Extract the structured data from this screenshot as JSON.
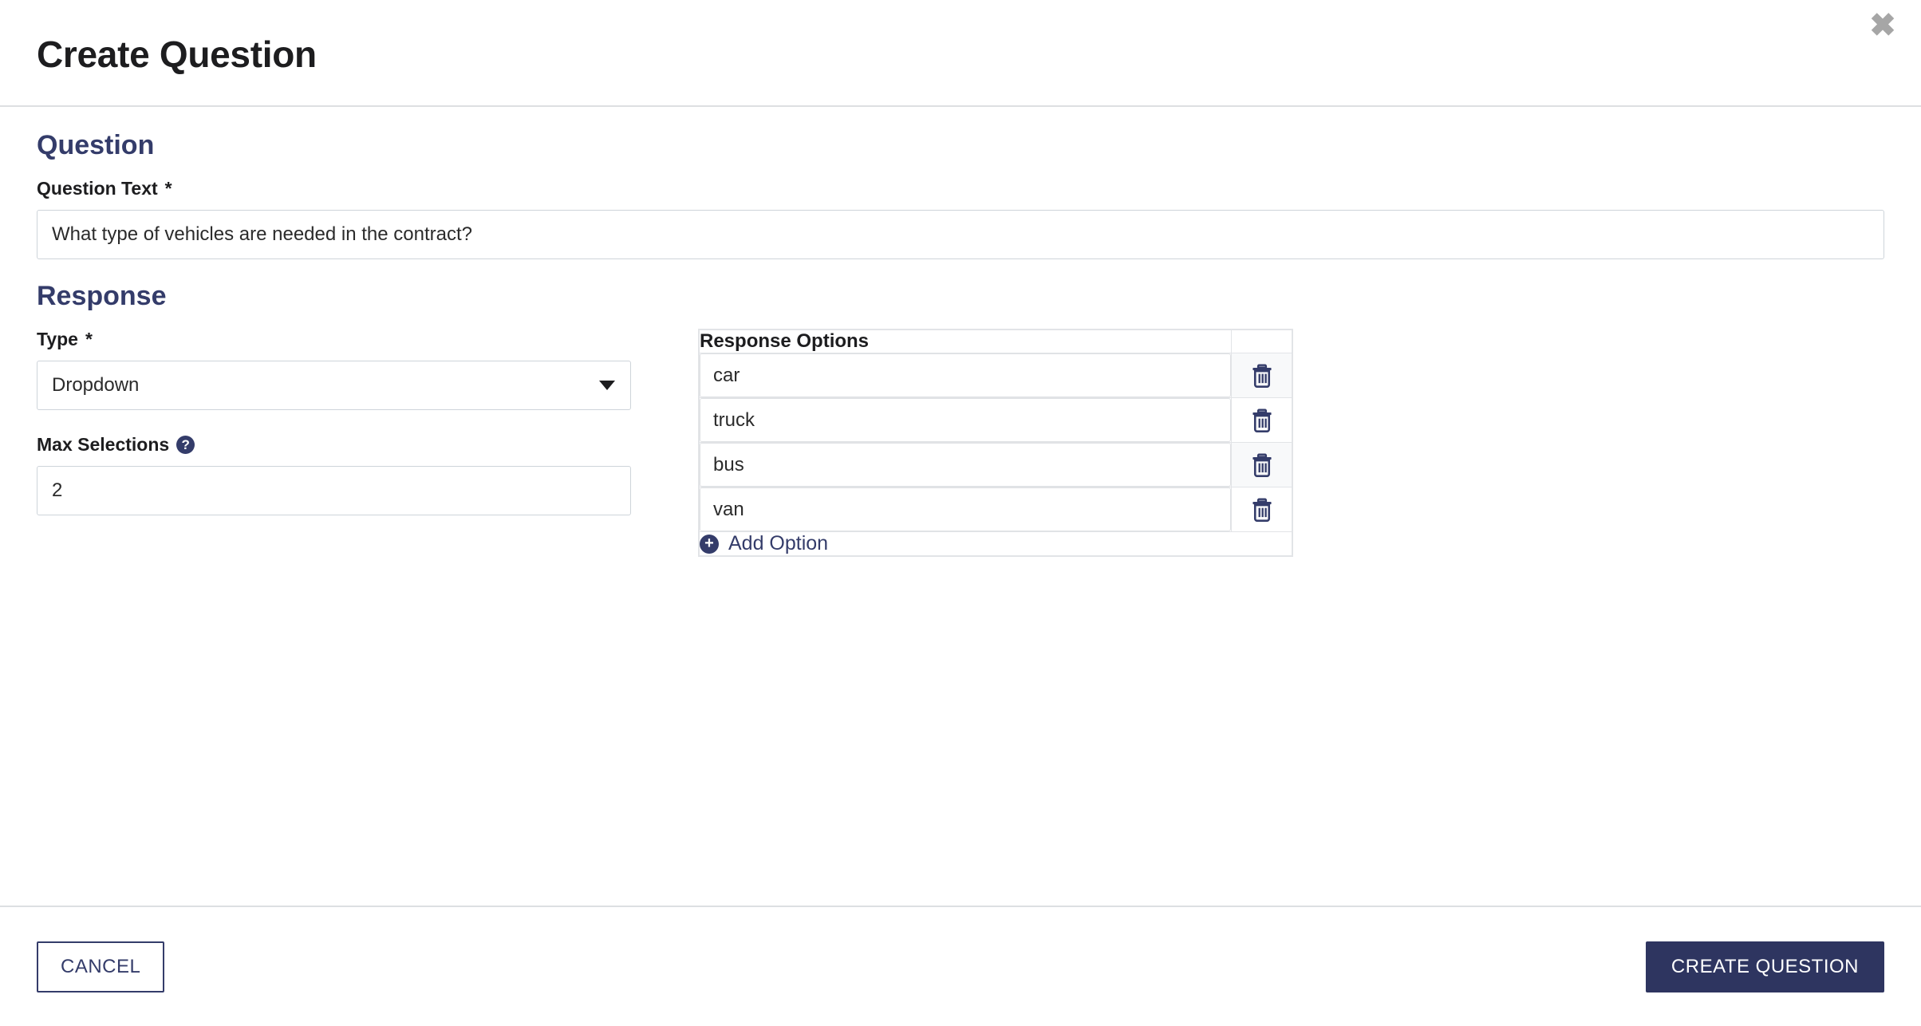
{
  "modal": {
    "title": "Create Question",
    "close_label": "✖"
  },
  "question_section": {
    "heading": "Question",
    "question_text_label": "Question Text",
    "required_marker": "*",
    "question_text_value": "What type of vehicles are needed in the contract?",
    "question_text_placeholder": ""
  },
  "response_section": {
    "heading": "Response",
    "type_label": "Type",
    "type_required_marker": "*",
    "type_value": "Dropdown",
    "type_options": [
      "Dropdown"
    ],
    "max_selections_label": "Max Selections",
    "max_selections_help": "?",
    "max_selections_value": "2",
    "max_selections_placeholder": ""
  },
  "options_table": {
    "header": "Response Options",
    "actions_header": "",
    "rows": [
      {
        "value": "car",
        "delete_label": "delete-option"
      },
      {
        "value": "truck",
        "delete_label": "delete-option"
      },
      {
        "value": "bus",
        "delete_label": "delete-option"
      },
      {
        "value": "van",
        "delete_label": "delete-option"
      }
    ],
    "add_option_label": "Add Option",
    "add_option_icon": "+"
  },
  "footer": {
    "cancel_label": "CANCEL",
    "submit_label": "CREATE QUESTION"
  },
  "colors": {
    "navy": "#343c6a",
    "navy_solid": "#2e3560",
    "border": "#ced4da",
    "divider": "#dddfe2",
    "close_gray": "#a6a6a6",
    "row_stripe": "#f8f9fa"
  }
}
